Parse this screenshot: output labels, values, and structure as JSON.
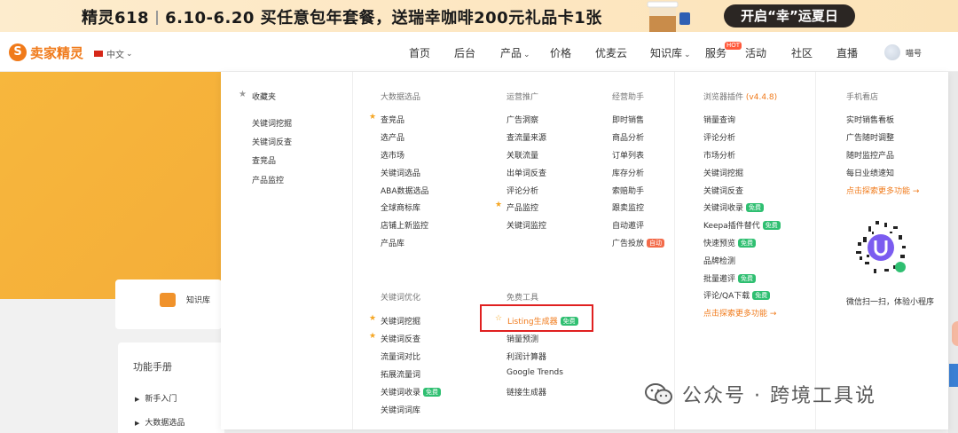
{
  "banner": {
    "text": "精灵618｜6.10-6.20 买任意包年套餐，送瑞幸咖啡200元礼品卡1张",
    "brand": "精灵618",
    "promo": "6.10-6.20 买任意包年套餐，送瑞幸咖啡200元礼品卡1张",
    "cta": "开启“幸”运夏日"
  },
  "nav": {
    "logo_mark": "S",
    "logo_text": "卖家精灵",
    "language": "中文",
    "items": [
      "首页",
      "后台",
      "产品",
      "价格",
      "优麦云",
      "知识库",
      "服务",
      "活动",
      "社区",
      "直播"
    ],
    "hot_badge": "HOT",
    "user": "喵号"
  },
  "background": {
    "knowledge_card": "知识库",
    "manual_title": "功能手册",
    "manual_items": [
      "新手入门",
      "大数据选品"
    ]
  },
  "menu": {
    "favorites": {
      "title": "收藏夹",
      "items": [
        "关键词挖掘",
        "关键词反查",
        "查竞品",
        "产品监控"
      ]
    },
    "big_data": {
      "title": "大数据选品",
      "items": [
        "查竞品",
        "选产品",
        "选市场",
        "关键词选品",
        "ABA数据选品",
        "全球商标库",
        "店铺上新监控",
        "产品库"
      ]
    },
    "ops": {
      "title": "运营推广",
      "items": [
        "广告洞察",
        "查流量来源",
        "关联流量",
        "出单词反查",
        "评论分析",
        "产品监控",
        "关键词监控"
      ]
    },
    "assist": {
      "title": "经营助手",
      "items": [
        "即时销售",
        "商品分析",
        "订单列表",
        "库存分析",
        "索赔助手",
        "跟卖监控",
        "自动邀评",
        "广告投放"
      ],
      "auto_badge": "自动"
    },
    "keyword_opt": {
      "title": "关键词优化",
      "items": [
        "关键词挖掘",
        "关键词反查",
        "流量词对比",
        "拓展流量词",
        "关键词收录",
        "关键词词库"
      ]
    },
    "free_tools": {
      "title": "免费工具",
      "items": [
        "Listing生成器",
        "销量预测",
        "利润计算器",
        "Google Trends",
        "链接生成器"
      ]
    },
    "browser": {
      "title": "浏览器插件",
      "version": "(v4.4.8)",
      "items": [
        "销量查询",
        "评论分析",
        "市场分析",
        "关键词挖掘",
        "关键词反查",
        "关键词收录",
        "Keepa插件替代",
        "快速预览",
        "品牌检测",
        "批量邀评",
        "评论/QA下载"
      ],
      "more": "点击探索更多功能 →"
    },
    "mobile": {
      "title": "手机看店",
      "items": [
        "实时销售看板",
        "广告随时调整",
        "随时监控产品",
        "每日业绩速知"
      ],
      "more": "点击探索更多功能 →",
      "qr_caption": "微信扫一扫，体验小程序"
    },
    "free_badge": "免费"
  },
  "watermark": "公众号 · 跨境工具说",
  "colors": {
    "accent": "#f07a1a",
    "free": "#2fbf71",
    "highlight": "#e02020",
    "star": "#f5a623"
  }
}
